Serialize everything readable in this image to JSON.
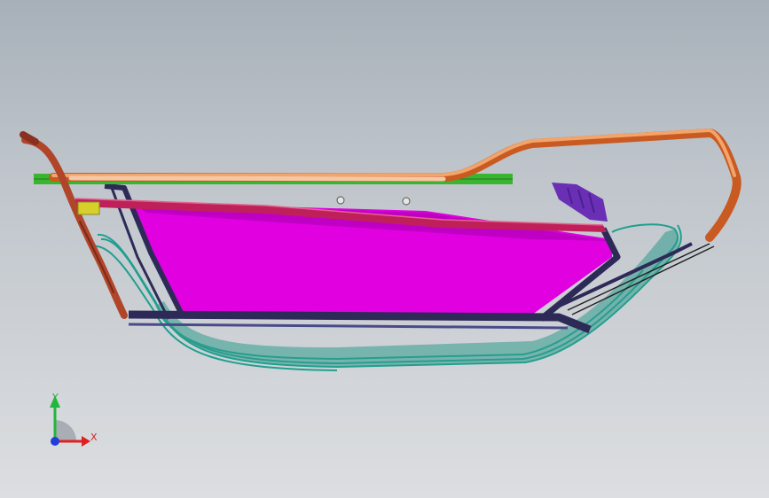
{
  "viewport": {
    "background_top": "#a7b0b9",
    "background_bottom": "#dcdee1"
  },
  "model": {
    "panel_color": "#e000e0",
    "frame_color": "#2d2a57",
    "seal_color": "#1f9f8f",
    "rail_color": "#e07a3a",
    "top_bar_color": "#c0205a",
    "green_rail_color": "#39b52f",
    "handle_color": "#b0452a"
  },
  "triad": {
    "y_label": "Y",
    "x_label": "X",
    "y_color": "#22b63c",
    "x_color": "#e02020",
    "z_color": "#1f3fd8"
  }
}
